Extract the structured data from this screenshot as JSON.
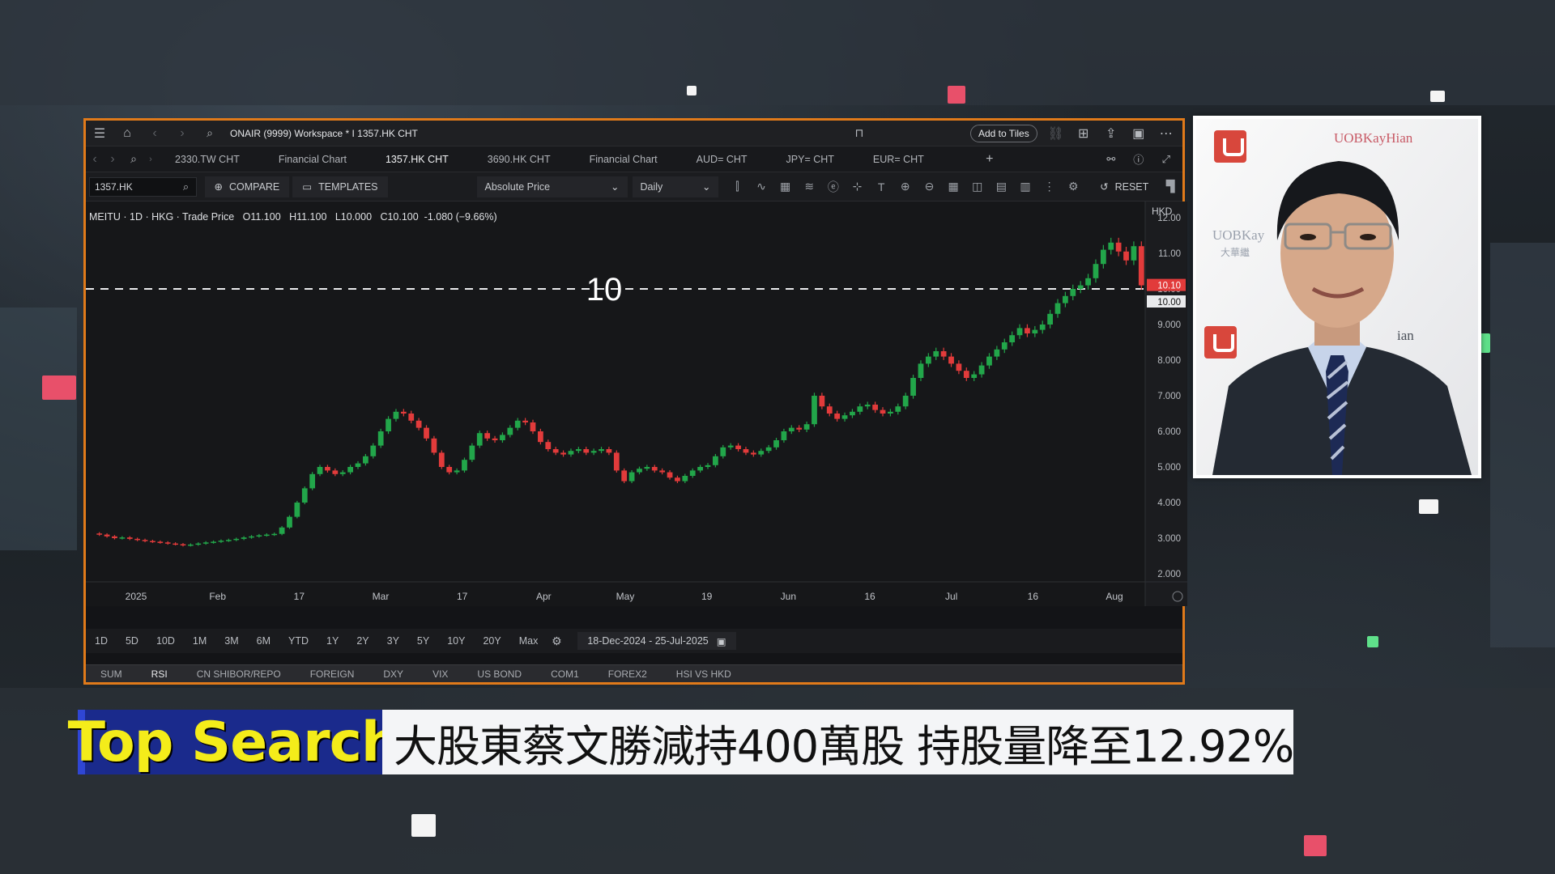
{
  "window": {
    "workspace_title": "ONAIR (9999) Workspace * I 1357.HK CHT",
    "add_to_tiles": "Add to Tiles"
  },
  "tabs": [
    {
      "label": "2330.TW CHT"
    },
    {
      "label": "Financial Chart"
    },
    {
      "label": "1357.HK CHT",
      "active": true
    },
    {
      "label": "3690.HK CHT"
    },
    {
      "label": "Financial Chart"
    },
    {
      "label": "AUD= CHT"
    },
    {
      "label": "JPY= CHT"
    },
    {
      "label": "EUR= CHT"
    }
  ],
  "toolbar": {
    "ric": "1357.HK",
    "compare": "COMPARE",
    "templates": "TEMPLATES",
    "price_type": "Absolute Price",
    "interval": "Daily",
    "reset": "RESET"
  },
  "legend": {
    "text": "MEITU · 1D · HKG · Trade Price",
    "open": "O11.100",
    "high": "H11.100",
    "low": "L10.000",
    "close": "C10.100",
    "change": "-1.080 (−9.66%)"
  },
  "chart_data": {
    "type": "candlestick",
    "currency": "HKD",
    "annotation": "10",
    "reference_line": 10.0,
    "last_price_label": "10.10",
    "line_label": "10.00",
    "ylim": [
      2.0,
      12.0
    ],
    "y_ticks": [
      "12.00",
      "11.00",
      "10.00",
      "9.000",
      "8.000",
      "7.000",
      "6.000",
      "5.000",
      "4.000",
      "3.000",
      "2.000"
    ],
    "x_ticks": [
      "2025",
      "Feb",
      "17",
      "Mar",
      "17",
      "Apr",
      "May",
      "19",
      "Jun",
      "16",
      "Jul",
      "16",
      "Aug"
    ],
    "date_range": "18-Dec-2024 - 25-Jul-2025",
    "closes": [
      3.1,
      3.05,
      3.0,
      3.02,
      2.98,
      2.95,
      2.92,
      2.9,
      2.88,
      2.85,
      2.83,
      2.8,
      2.82,
      2.85,
      2.88,
      2.9,
      2.93,
      2.95,
      2.98,
      3.02,
      3.05,
      3.08,
      3.1,
      3.12,
      3.3,
      3.6,
      4.0,
      4.4,
      4.8,
      5.0,
      4.9,
      4.8,
      4.85,
      5.0,
      5.1,
      5.3,
      5.6,
      6.0,
      6.35,
      6.55,
      6.5,
      6.3,
      6.1,
      5.8,
      5.4,
      5.0,
      4.85,
      4.9,
      5.2,
      5.6,
      5.95,
      5.8,
      5.75,
      5.9,
      6.1,
      6.3,
      6.25,
      6.0,
      5.7,
      5.5,
      5.4,
      5.35,
      5.45,
      5.5,
      5.4,
      5.45,
      5.5,
      5.4,
      4.9,
      4.6,
      4.85,
      4.95,
      5.0,
      4.9,
      4.85,
      4.7,
      4.6,
      4.75,
      4.9,
      5.0,
      5.05,
      5.3,
      5.55,
      5.6,
      5.5,
      5.4,
      5.35,
      5.45,
      5.55,
      5.75,
      6.0,
      6.1,
      6.05,
      6.2,
      7.0,
      6.7,
      6.5,
      6.35,
      6.45,
      6.55,
      6.7,
      6.75,
      6.6,
      6.5,
      6.55,
      6.7,
      7.0,
      7.5,
      7.9,
      8.1,
      8.25,
      8.1,
      7.9,
      7.7,
      7.5,
      7.6,
      7.85,
      8.1,
      8.3,
      8.5,
      8.7,
      8.9,
      8.75,
      8.85,
      9.0,
      9.3,
      9.6,
      9.8,
      10.0,
      10.1,
      10.3,
      10.7,
      11.1,
      11.3,
      11.05,
      10.8,
      11.2,
      10.1
    ]
  },
  "periods": [
    "1D",
    "5D",
    "10D",
    "1M",
    "3M",
    "6M",
    "YTD",
    "1Y",
    "2Y",
    "3Y",
    "5Y",
    "10Y",
    "20Y",
    "Max"
  ],
  "footer_tabs": [
    {
      "label": "SUM"
    },
    {
      "label": "RSI",
      "active": true
    },
    {
      "label": "CN SHIBOR/REPO"
    },
    {
      "label": "FOREIGN"
    },
    {
      "label": "DXY"
    },
    {
      "label": "VIX"
    },
    {
      "label": "US BOND"
    },
    {
      "label": "COM1"
    },
    {
      "label": "FOREX2"
    },
    {
      "label": "HSI VS HKD"
    }
  ],
  "video": {
    "brand_top": "UOBKayHian",
    "brand_mid": "UOBKay",
    "brand_small": "大華繼",
    "brand_low": "ian"
  },
  "ticker": {
    "label": "Top Search",
    "headline": "大股東蔡文勝減持400萬股 持股量降至12.92%"
  },
  "colors": {
    "up": "#22a64a",
    "down": "#e23b3b",
    "frame": "#e07a1a",
    "ticker_label_bg": "#1a2a8c",
    "ticker_label_text": "#f4ec1a"
  }
}
